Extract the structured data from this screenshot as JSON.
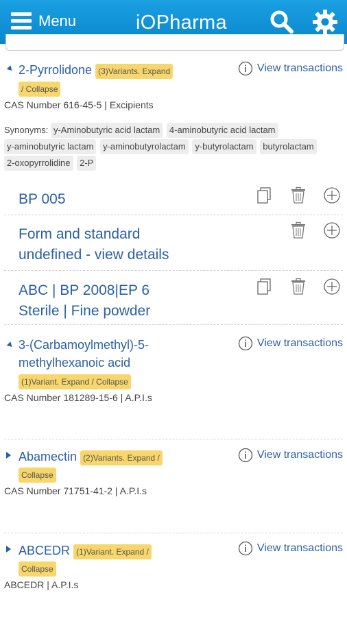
{
  "header": {
    "menu_label": "Menu",
    "logo": "iOPharma",
    "bg_color": "#0a96d8"
  },
  "products": [
    {
      "name": "2-Pyrrolidone",
      "badge_line1": "(3)Variants. Expand",
      "badge_line2": "/ Collapse",
      "cas": "CAS Number  616-45-5 | Excipients",
      "view_transactions": "View transactions",
      "synonyms_label": "Synonyms:",
      "synonyms": [
        "y-Aminobutyric acid lactam",
        "4-aminobutyric acid lactam",
        "y-aminobutyric lactam",
        "y-aminobutyrolactam",
        "y-butyrolactam",
        "butyrolactam",
        "2-oxopyrrolidine",
        "2-P"
      ],
      "variants": [
        {
          "line1": "BP 005",
          "line2": ""
        },
        {
          "line1": "Form and standard",
          "line2": "undefined - view details"
        },
        {
          "line1": "ABC | BP 2008|EP 6",
          "line2": "Sterile | Fine powder"
        }
      ]
    },
    {
      "name_line1": "3-(Carbamoylmethyl)-5-",
      "name_line2": "methylhexanoic acid",
      "badge_line1": "(1)Variant. Expand / Collapse",
      "cas": "CAS Number  181289-15-6 | A.P.I.s",
      "view_transactions": "View transactions"
    },
    {
      "name": "Abamectin",
      "badge_line1": "(2)Variants. Expand /",
      "badge_line2": "Collapse",
      "cas": "CAS Number  71751-41-2 | A.P.I.s",
      "view_transactions": "View transactions"
    },
    {
      "name": "ABCEDR",
      "badge_line1": "(1)Variant. Expand /",
      "badge_line2": "Collapse",
      "cas": "ABCEDR | A.P.I.s",
      "view_transactions": "View transactions"
    }
  ],
  "icons": {
    "menu": "hamburger-icon",
    "search": "search-icon",
    "settings": "gear-icon",
    "info": "info-icon",
    "copy": "copy-icon",
    "delete": "trash-icon",
    "add": "plus-circle-icon"
  },
  "colors": {
    "link": "#2a5fa8",
    "badge": "#f7d66b",
    "tag": "#ededed"
  }
}
